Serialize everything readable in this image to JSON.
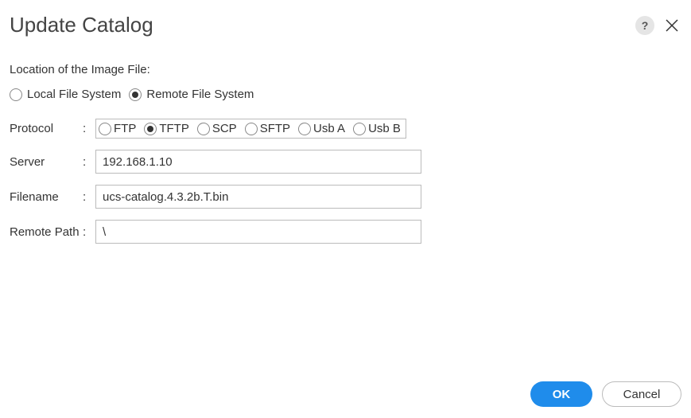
{
  "header": {
    "title": "Update Catalog",
    "help": "?",
    "close": "×"
  },
  "section_label": "Location of the Image File:",
  "location": {
    "options": [
      {
        "label": "Local File System",
        "selected": false
      },
      {
        "label": "Remote File System",
        "selected": true
      }
    ]
  },
  "fields": {
    "protocol": {
      "label": "Protocol",
      "options": [
        {
          "label": "FTP",
          "selected": false
        },
        {
          "label": "TFTP",
          "selected": true
        },
        {
          "label": "SCP",
          "selected": false
        },
        {
          "label": "SFTP",
          "selected": false
        },
        {
          "label": "Usb A",
          "selected": false
        },
        {
          "label": "Usb B",
          "selected": false
        }
      ]
    },
    "server": {
      "label": "Server",
      "value": "192.168.1.10"
    },
    "filename": {
      "label": "Filename",
      "value": "ucs-catalog.4.3.2b.T.bin"
    },
    "remote_path": {
      "label": "Remote Path",
      "value": "\\"
    }
  },
  "footer": {
    "ok": "OK",
    "cancel": "Cancel"
  }
}
